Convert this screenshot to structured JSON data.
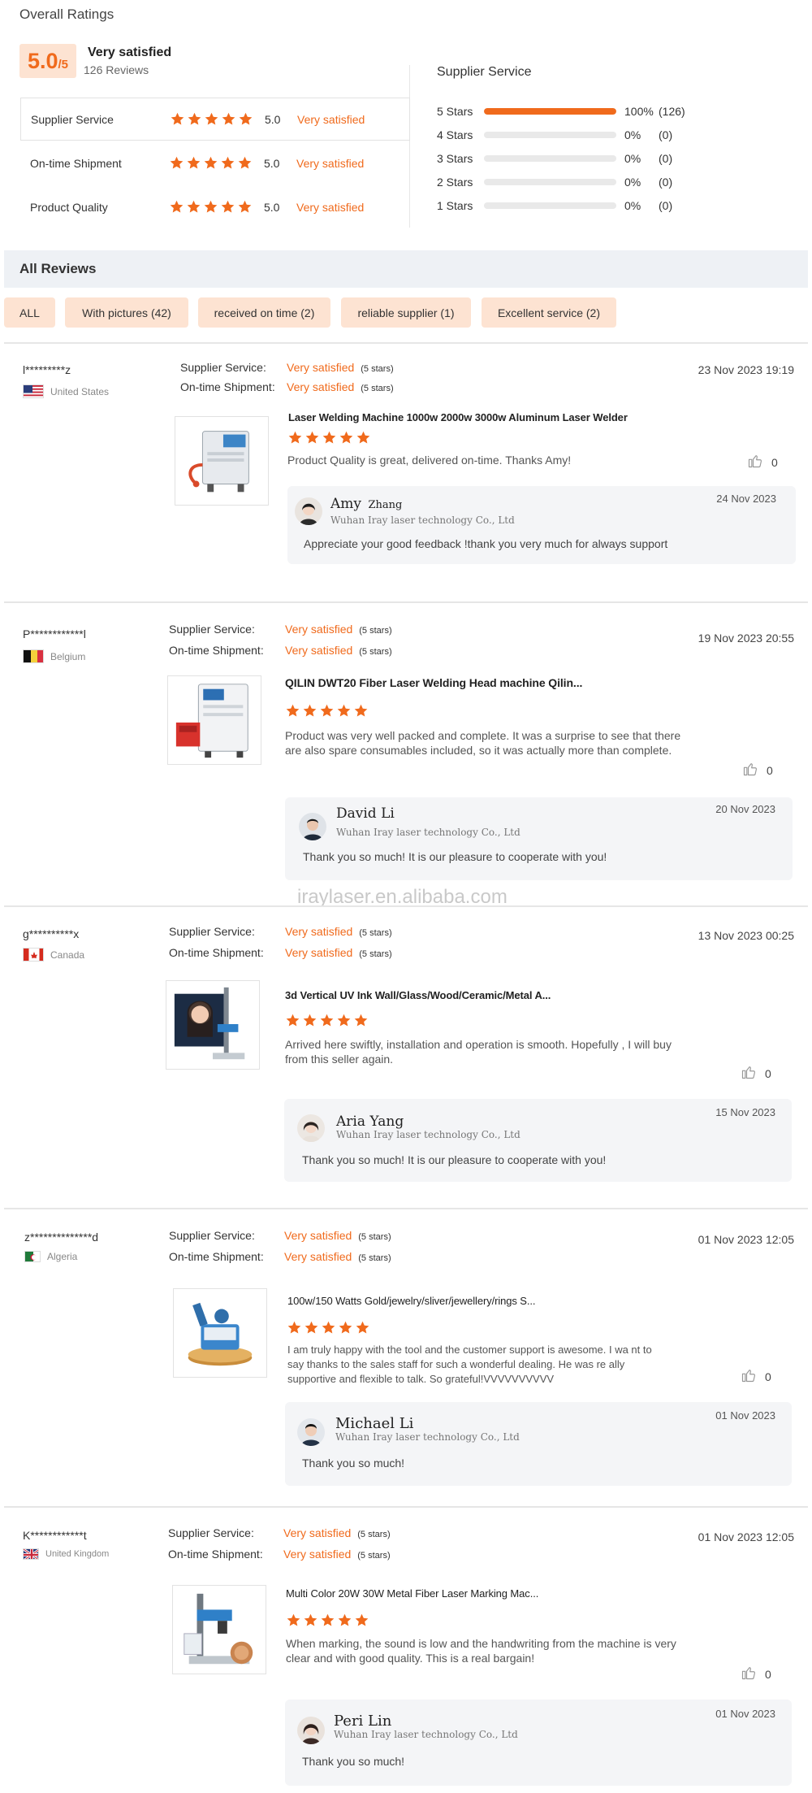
{
  "overall": {
    "title": "Overall Ratings",
    "score": "5.0",
    "score_max": "/5",
    "label": "Very satisfied",
    "reviews_count": "126 Reviews",
    "rows": [
      {
        "label": "Supplier Service",
        "value": "5.0",
        "text": "Very satisfied",
        "stars": 5
      },
      {
        "label": "On-time Shipment",
        "value": "5.0",
        "text": "Very satisfied",
        "stars": 5
      },
      {
        "label": "Product Quality",
        "value": "5.0",
        "text": "Very satisfied",
        "stars": 5
      }
    ]
  },
  "distribution": {
    "title": "Supplier Service",
    "rows": [
      {
        "label": "5 Stars",
        "percent": "100%",
        "count": "(126)",
        "fill": 1.0
      },
      {
        "label": "4 Stars",
        "percent": "0%",
        "count": "(0)",
        "fill": 0
      },
      {
        "label": "3 Stars",
        "percent": "0%",
        "count": "(0)",
        "fill": 0
      },
      {
        "label": "2 Stars",
        "percent": "0%",
        "count": "(0)",
        "fill": 0
      },
      {
        "label": "1 Stars",
        "percent": "0%",
        "count": "(0)",
        "fill": 0
      }
    ]
  },
  "all_reviews": {
    "title": "All Reviews",
    "filters": [
      "ALL",
      "With pictures (42)",
      "received on time (2)",
      "reliable supplier (1)",
      "Excellent service (2)"
    ]
  },
  "watermark": "iraylaser.en.alibaba.com",
  "labels": {
    "supplier_service": "Supplier Service:",
    "ontime_shipment": "On-time Shipment:",
    "very_satisfied": "Very satisfied",
    "five_stars": "(5 stars)"
  },
  "accent_color": "#f06a1c",
  "reviews": [
    {
      "user": "l*********z",
      "country": "United States",
      "flag": "us",
      "date": "23 Nov 2023 19:19",
      "product": "Laser Welding Machine 1000w 2000w 3000w Aluminum Laser Welder",
      "rating": 5,
      "text": "Product Quality is great, delivered on-time. Thanks Amy!",
      "likes": "0",
      "reply": {
        "name": "Amy Zhang",
        "name_first": "Amy",
        "name_last": "Zhang",
        "company": "Wuhan Iray laser technology Co., Ltd",
        "date": "24 Nov 2023",
        "text": "Appreciate your good feedback !thank you very much for always support"
      }
    },
    {
      "user": "P************l",
      "country": "Belgium",
      "flag": "be",
      "date": "19 Nov 2023 20:55",
      "product": "QILIN DWT20 Fiber Laser Welding Head machine Qilin...",
      "rating": 5,
      "text": "Product was very well packed and complete. It was a surprise to see that there are also spare consumables  included, so it was actually more than complete.",
      "likes": "0",
      "reply": {
        "name": "David Li",
        "company": "Wuhan Iray laser technology Co., Ltd",
        "date": "20 Nov 2023",
        "text": "Thank you so much! It is our pleasure to cooperate with you!"
      }
    },
    {
      "user": "g**********x",
      "country": "Canada",
      "flag": "ca",
      "date": "13 Nov 2023 00:25",
      "product": "3d Vertical UV Ink Wall/Glass/Wood/Ceramic/Metal A...",
      "rating": 5,
      "text": "Arrived here swiftly, installation and operation is smooth. Hopefully , I will buy from this seller again.",
      "likes": "0",
      "reply": {
        "name": "Aria Yang",
        "company": "Wuhan Iray laser technology Co., Ltd",
        "date": "15 Nov 2023",
        "text": "Thank you so much! It is our pleasure to cooperate with you!"
      }
    },
    {
      "user": "z**************d",
      "country": "Algeria",
      "flag": "dz",
      "date": "01 Nov 2023 12:05",
      "product": "100w/150 Watts Gold/jewelry/sliver/jewellery/rings S...",
      "rating": 5,
      "text": "I am truly happy with the tool and the customer support is awesome. I wa nt to say thanks to the sales staff for such a wonderful dealing. He was re ally supportive and flexible to talk. So grateful!VVVVVVVVVV",
      "likes": "0",
      "reply": {
        "name": "Michael Li",
        "company": "Wuhan Iray laser technology Co., Ltd",
        "date": "01 Nov 2023",
        "text": "Thank you so much!"
      }
    },
    {
      "user": "K************t",
      "country": "United Kingdom",
      "flag": "gb",
      "date": "01 Nov 2023 12:05",
      "product": "Multi Color 20W 30W Metal Fiber Laser Marking Mac...",
      "rating": 5,
      "text": "When marking, the sound is low and the handwriting from the machine is very clear and with good quality. This is a real bargain!",
      "likes": "0",
      "reply": {
        "name": "Peri Lin",
        "company": "Wuhan Iray laser technology Co., Ltd",
        "date": "01 Nov 2023",
        "text": "Thank you so much!"
      }
    }
  ]
}
